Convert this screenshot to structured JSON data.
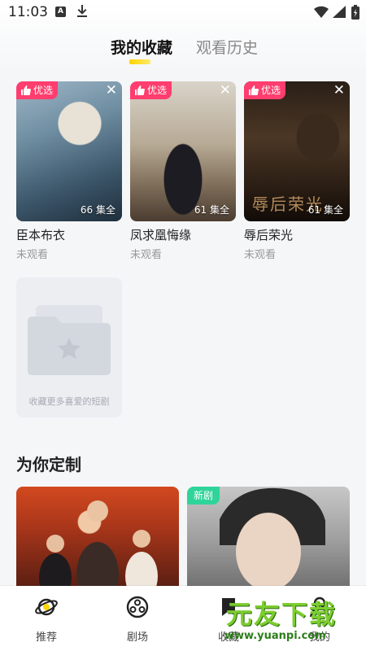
{
  "status_bar": {
    "time": "11:03",
    "a_icon_letter": "A"
  },
  "tabs": [
    {
      "label": "我的收藏",
      "active": true
    },
    {
      "label": "观看历史",
      "active": false
    }
  ],
  "favorites": [
    {
      "title": "臣本布衣",
      "status": "未观看",
      "badge": "优选",
      "episodes": "66 集全"
    },
    {
      "title": "凤求凰悔缘",
      "status": "未观看",
      "badge": "优选",
      "episodes": "61 集全"
    },
    {
      "title": "辱后荣光",
      "status": "未观看",
      "badge": "优选",
      "episodes": "61 集全",
      "poster_caption": "辱后荣光"
    }
  ],
  "empty_card": {
    "hint": "收藏更多喜爱的短剧"
  },
  "recommend": {
    "title": "为你定制",
    "items": [
      {
        "badge": ""
      },
      {
        "badge": "新剧"
      }
    ]
  },
  "bottom_nav": [
    {
      "label": "推荐",
      "icon": "planet-icon"
    },
    {
      "label": "剧场",
      "icon": "film-reel-icon"
    },
    {
      "label": "收藏",
      "icon": "bookmark-icon"
    },
    {
      "label": "我的",
      "icon": "profile-icon"
    }
  ],
  "watermark": {
    "text": "元友下载",
    "url": "www.yuanpi.com"
  },
  "colors": {
    "accent_yellow": "#ffd400",
    "badge_pink": "#ff3d6e",
    "badge_green": "#2fd49a"
  }
}
